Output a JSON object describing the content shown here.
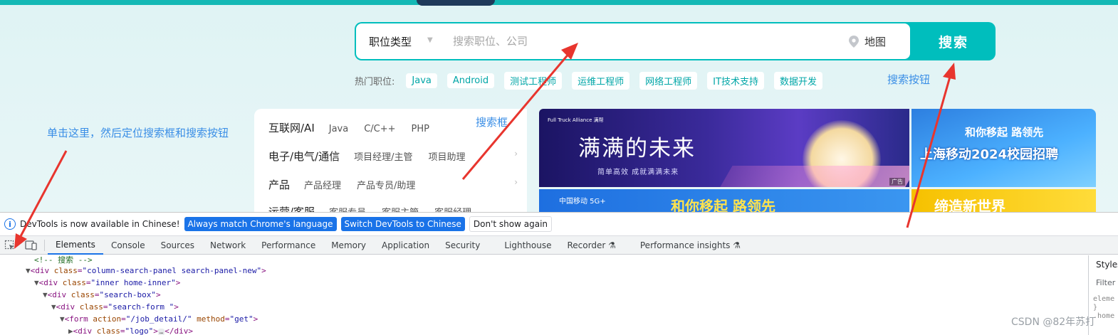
{
  "search": {
    "job_type_label": "职位类型",
    "placeholder": "搜索职位、公司",
    "map_label": "地图",
    "button_label": "搜索"
  },
  "hot_jobs": {
    "label": "热门职位:",
    "tags": [
      "Java",
      "Android",
      "测试工程师",
      "运维工程师",
      "网络工程师",
      "IT技术支持",
      "数据开发"
    ]
  },
  "annotations": {
    "search_button": "搜索按钮",
    "search_box": "搜索框",
    "click_here": "单击这里，然后定位搜索框和搜索按钮",
    "arrow_color": "#e8352e"
  },
  "categories": [
    {
      "title": "互联网/AI",
      "items": [
        "Java",
        "C/C++",
        "PHP"
      ]
    },
    {
      "title": "电子/电气/通信",
      "items": [
        "项目经理/主管",
        "项目助理"
      ]
    },
    {
      "title": "产品",
      "items": [
        "产品经理",
        "产品专员/助理"
      ]
    },
    {
      "title": "运营/客服",
      "items": [
        "客服专员",
        "客服主管",
        "客服经理"
      ]
    }
  ],
  "banners": {
    "b1_logo": "Full Truck Alliance 满帮",
    "b1_title": "满满的未来",
    "b1_sub": "简单高效 成就满满未来",
    "b1_ad": "广告",
    "b2_top": "和你移起 路领先",
    "b2_main": "上海移动2024校园招聘",
    "b3_logo": "中国移动 5G+",
    "b3_text": "和你移起 路领先",
    "b4_text": "缔造新世界"
  },
  "devtools": {
    "notice_text": "DevTools is now available in Chinese!",
    "btn_match": "Always match Chrome's language",
    "btn_switch": "Switch DevTools to Chinese",
    "btn_dismiss": "Don't show again",
    "tabs": [
      "Elements",
      "Console",
      "Sources",
      "Network",
      "Performance",
      "Memory",
      "Application",
      "Security",
      "Lighthouse",
      "Recorder",
      "Performance insights"
    ],
    "active_tab": "Elements",
    "styles_tab": "Styles",
    "filter_placeholder": "Filter",
    "styles_code": "eleme\n}\n.home"
  },
  "dom": {
    "comment": "<!-- 搜索 -->",
    "line1_tag": "div",
    "line1_class": "column-search-panel search-panel-new",
    "line2_tag": "div",
    "line2_class": "inner home-inner",
    "line3_tag": "div",
    "line3_class": "search-box",
    "line4_tag": "div",
    "line4_class": "search-form ",
    "line5_tag": "form",
    "line5_action": "/job_detail/",
    "line5_method": "get",
    "line6_tag": "div",
    "line6_class": "logo",
    "ellipsis": "…"
  },
  "watermark": "CSDN @82年苏打"
}
